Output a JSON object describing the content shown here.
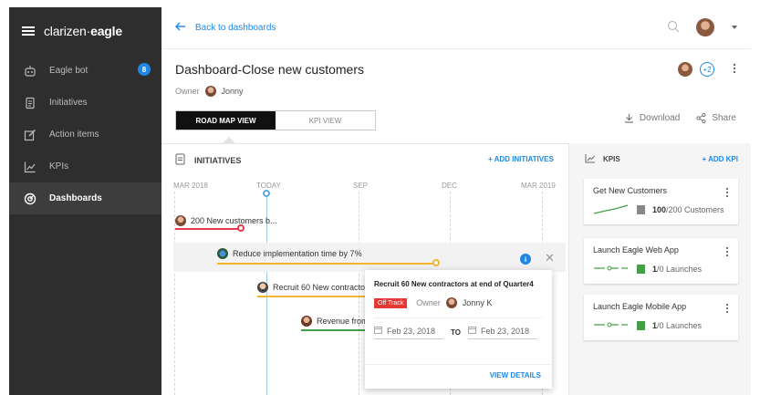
{
  "sidebar": {
    "brand": "clarizen",
    "brand_bold": "eagle",
    "items": [
      {
        "label": "Eagle bot",
        "badge": "8",
        "icon": "bot-icon"
      },
      {
        "label": "Initiatives",
        "icon": "document-icon"
      },
      {
        "label": "Action items",
        "icon": "edit-icon"
      },
      {
        "label": "KPIs",
        "icon": "trend-icon"
      },
      {
        "label": "Dashboards",
        "icon": "dashboard-icon",
        "active": true
      }
    ]
  },
  "topbar": {
    "back_label": "Back to dashboards"
  },
  "dashboard": {
    "title": "Dashboard-Close new customers",
    "owner_label": "Owner",
    "owner_name": "Jonny",
    "followers_more": "+2"
  },
  "views": {
    "roadmap": "ROAD MAP VIEW",
    "kpi": "KPI VIEW"
  },
  "actions": {
    "download": "Download",
    "share": "Share"
  },
  "initiatives": {
    "header": "INITIATIVES",
    "add_label": "+ ADD INITIATIVES",
    "timeline": {
      "mar2018": "MAR 2018",
      "today": "TODAY",
      "sep": "SEP",
      "dec": "DEC",
      "mar2019": "MAR 2019"
    },
    "rows": [
      {
        "label": "200 New customers b..."
      },
      {
        "label": "Reduce implementation time by 7%"
      },
      {
        "label": "Recruit 60 New contractors"
      },
      {
        "label": "Revenue from"
      }
    ]
  },
  "popup": {
    "title": "Recruit 60 New contractors at end of Quarter4",
    "status": "Off Track",
    "owner_label": "Owner",
    "owner_name": "Jonny K",
    "date_from": "Feb 23, 2018",
    "to_label": "TO",
    "date_to": "Feb 23, 2018",
    "view_details": "VIEW DETAILS"
  },
  "kpis": {
    "header": "KPIS",
    "add_label": "+ ADD KPI",
    "cards": [
      {
        "title": "Get New Customers",
        "value": "100",
        "total": "/200 Customers"
      },
      {
        "title": "Launch Eagle Web App",
        "value": "1",
        "total": "/0 Launches"
      },
      {
        "title": "Launch Eagle Mobile App",
        "value": "1",
        "total": "/0 Launches"
      }
    ]
  },
  "colors": {
    "accent": "#1e88e5",
    "off_track": "#e53935",
    "bar_red": "#e53950",
    "bar_yellow": "#f2b632",
    "bar_green": "#43a047"
  }
}
